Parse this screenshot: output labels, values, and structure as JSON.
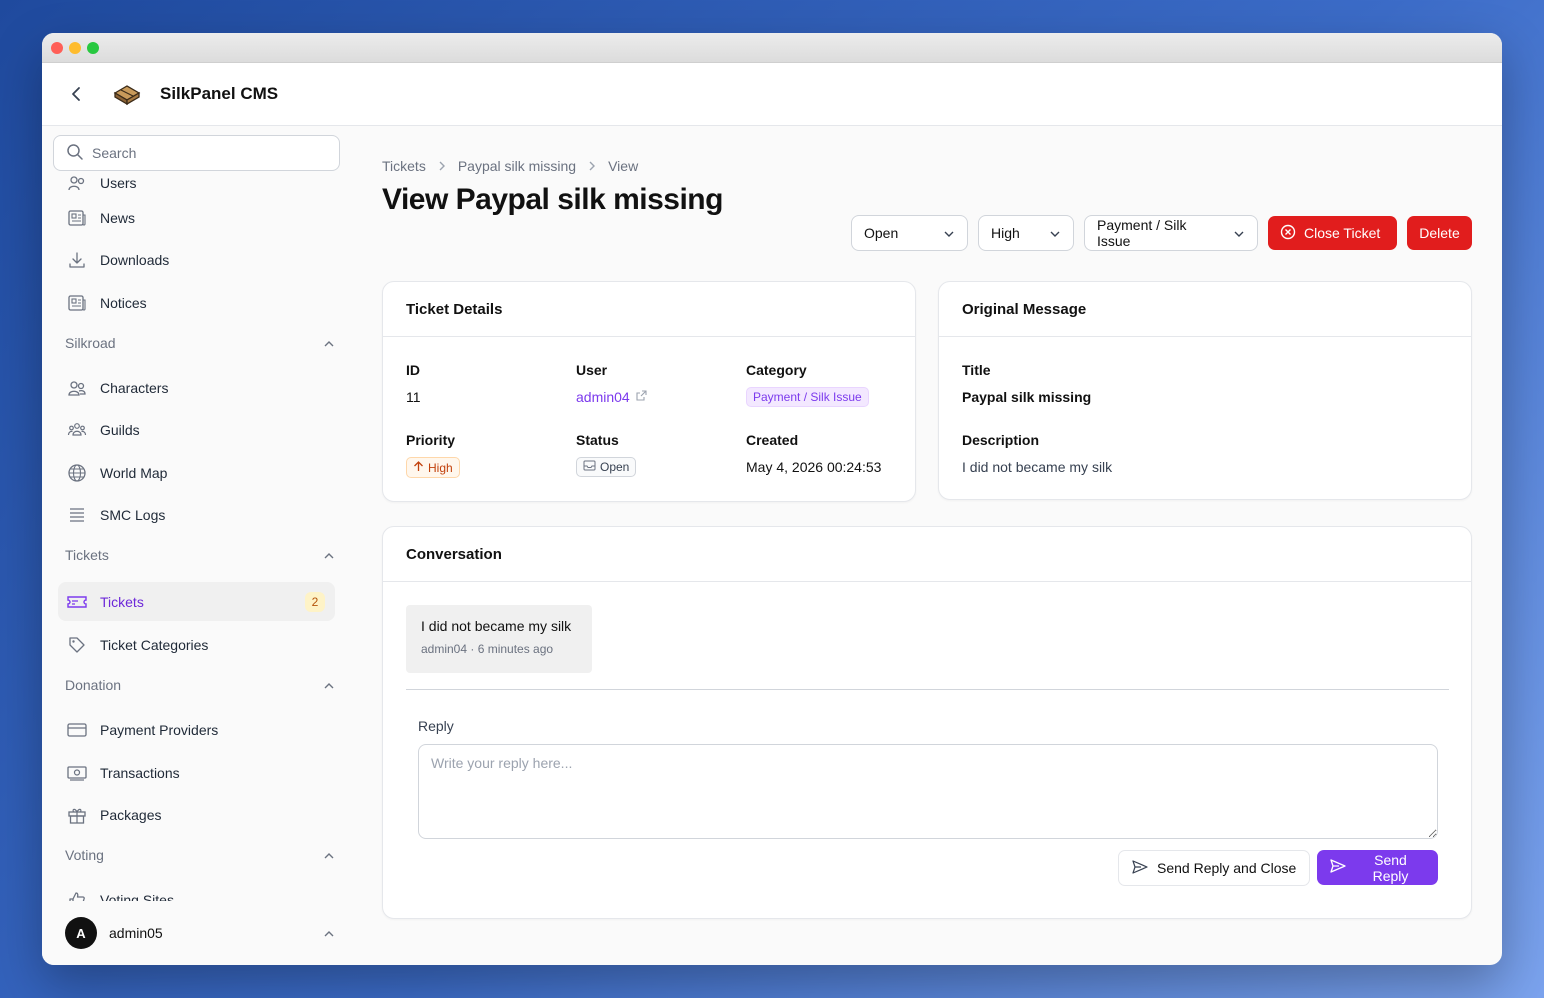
{
  "app": {
    "title": "SilkPanel CMS"
  },
  "search": {
    "placeholder": "Search"
  },
  "sidebar": {
    "partial_top_label": "Users",
    "items_top": [
      {
        "label": "News",
        "icon": "newspaper-icon"
      },
      {
        "label": "Downloads",
        "icon": "download-icon"
      },
      {
        "label": "Notices",
        "icon": "newspaper-icon"
      }
    ],
    "groups": {
      "silkroad": {
        "label": "Silkroad",
        "items": [
          {
            "label": "Characters",
            "icon": "users-icon"
          },
          {
            "label": "Guilds",
            "icon": "user-group-icon"
          },
          {
            "label": "World Map",
            "icon": "globe-icon"
          },
          {
            "label": "SMC Logs",
            "icon": "list-icon"
          }
        ]
      },
      "tickets": {
        "label": "Tickets",
        "items": [
          {
            "label": "Tickets",
            "icon": "ticket-icon",
            "badge": "2",
            "active": true
          },
          {
            "label": "Ticket Categories",
            "icon": "tag-icon"
          }
        ]
      },
      "donation": {
        "label": "Donation",
        "items": [
          {
            "label": "Payment Providers",
            "icon": "credit-card-icon"
          },
          {
            "label": "Transactions",
            "icon": "banknote-icon"
          },
          {
            "label": "Packages",
            "icon": "gift-icon"
          }
        ]
      },
      "voting": {
        "label": "Voting",
        "items": [
          {
            "label": "Voting Sites",
            "icon": "thumbs-up-icon"
          }
        ]
      }
    },
    "user": {
      "initial": "A",
      "name": "admin05"
    }
  },
  "breadcrumb": [
    "Tickets",
    "Paypal silk missing",
    "View"
  ],
  "page_title": "View Paypal silk missing",
  "actions": {
    "status_select": "Open",
    "priority_select": "High",
    "category_select": "Payment / Silk Issue",
    "close_ticket": "Close Ticket",
    "delete": "Delete"
  },
  "ticket_details": {
    "heading": "Ticket Details",
    "id_label": "ID",
    "id": "11",
    "user_label": "User",
    "user": "admin04",
    "category_label": "Category",
    "category": "Payment / Silk Issue",
    "priority_label": "Priority",
    "priority": "High",
    "status_label": "Status",
    "status": "Open",
    "created_label": "Created",
    "created": "May 4, 2026 00:24:53"
  },
  "original_message": {
    "heading": "Original Message",
    "title_label": "Title",
    "title": "Paypal silk missing",
    "description_label": "Description",
    "description": "I did not became my silk"
  },
  "conversation": {
    "heading": "Conversation",
    "messages": [
      {
        "text": "I did not became my silk",
        "meta": "admin04 · 6 minutes ago"
      }
    ],
    "reply_label": "Reply",
    "reply_placeholder": "Write your reply here...",
    "send_close": "Send Reply and Close",
    "send": "Send Reply"
  },
  "colors": {
    "accent": "#7c3aed",
    "danger": "#e11d1d"
  }
}
